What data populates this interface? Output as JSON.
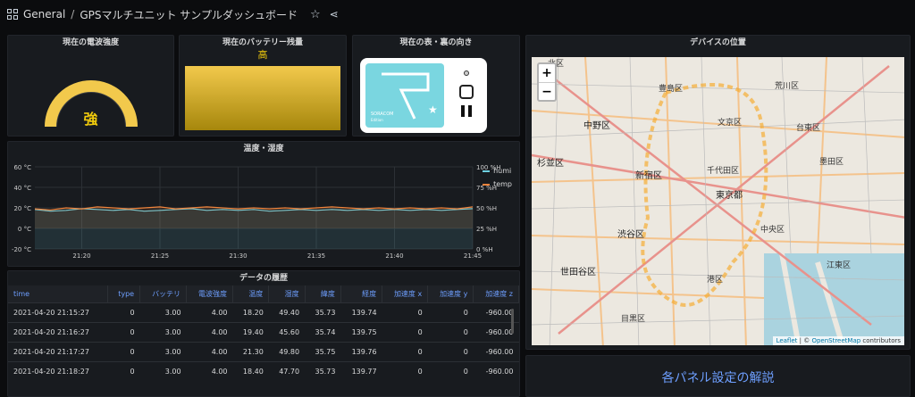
{
  "breadcrumb": {
    "folder": "General",
    "separator": "/",
    "dashboard": "GPSマルチユニット サンプルダッシュボード"
  },
  "panels": {
    "signal": {
      "title": "現在の電波強度",
      "value": "強",
      "level": 0.85
    },
    "battery": {
      "title": "現在のバッテリー残量",
      "value": "高",
      "level": 1.0
    },
    "orientation": {
      "title": "現在の表・裏の向き",
      "brand": "SORACOM",
      "sub": "Edition"
    },
    "chart": {
      "title": "温度・湿度"
    },
    "table": {
      "title": "データの履歴"
    },
    "map": {
      "title": "デバイスの位置"
    },
    "explain": {
      "title": "各パネル設定の解説"
    }
  },
  "chart_data": {
    "type": "line",
    "x": [
      "21:17",
      "21:18",
      "21:19",
      "21:20",
      "21:21",
      "21:22",
      "21:23",
      "21:24",
      "21:25",
      "21:26",
      "21:27",
      "21:28",
      "21:29",
      "21:30",
      "21:31",
      "21:32",
      "21:33",
      "21:34",
      "21:35",
      "21:36",
      "21:37",
      "21:38",
      "21:39",
      "21:40",
      "21:41",
      "21:42",
      "21:43",
      "21:44",
      "21:45"
    ],
    "x_ticks": [
      "21:20",
      "21:25",
      "21:30",
      "21:35",
      "21:40",
      "21:45"
    ],
    "left_axis": {
      "ticks": [
        "60 °C",
        "40 °C",
        "20 °C",
        "0 °C",
        "-20 °C"
      ],
      "ylim": [
        -20,
        60
      ]
    },
    "right_axis": {
      "ticks": [
        "100 %H",
        "75 %H",
        "50 %H",
        "25 %H",
        "0 %H"
      ],
      "ylim": [
        0,
        100
      ]
    },
    "series": [
      {
        "name": "humi",
        "color": "#6ed0e0",
        "axis": "right",
        "values": [
          48,
          46,
          47,
          49,
          48,
          47,
          48,
          46,
          47,
          48,
          49,
          47,
          48,
          47,
          48,
          46,
          47,
          48,
          47,
          48,
          47,
          48,
          47,
          48,
          47,
          48,
          47,
          48,
          49
        ]
      },
      {
        "name": "temp",
        "color": "#ef843c",
        "axis": "left",
        "values": [
          19,
          18,
          20,
          19,
          21,
          20,
          19,
          20,
          21,
          19,
          20,
          21,
          20,
          19,
          20,
          19,
          20,
          19,
          20,
          21,
          20,
          19,
          20,
          19,
          20,
          19,
          20,
          19,
          21
        ]
      }
    ]
  },
  "table": {
    "columns": [
      "time",
      "type",
      "バッテリ",
      "電波強度",
      "温度",
      "湿度",
      "緯度",
      "経度",
      "加速度 x",
      "加速度 y",
      "加速度 z"
    ],
    "rows": [
      [
        "2021-04-20 21:15:27",
        "0",
        "3.00",
        "4.00",
        "18.20",
        "49.40",
        "35.73",
        "139.74",
        "0",
        "0",
        "-960.00"
      ],
      [
        "2021-04-20 21:16:27",
        "0",
        "3.00",
        "4.00",
        "19.40",
        "45.60",
        "35.74",
        "139.75",
        "0",
        "0",
        "-960.00"
      ],
      [
        "2021-04-20 21:17:27",
        "0",
        "3.00",
        "4.00",
        "21.30",
        "49.80",
        "35.75",
        "139.76",
        "0",
        "0",
        "-960.00"
      ],
      [
        "2021-04-20 21:18:27",
        "0",
        "3.00",
        "4.00",
        "18.40",
        "47.70",
        "35.73",
        "139.77",
        "0",
        "0",
        "-960.00"
      ]
    ]
  },
  "map": {
    "zoom_in": "+",
    "zoom_out": "−",
    "attribution_leaflet": "Leaflet",
    "attribution_sep": " | © ",
    "attribution_osm": "OpenStreetMap",
    "attribution_tail": " contributors",
    "labels": [
      "豊島区",
      "荒川区",
      "北区",
      "中野区",
      "文京区",
      "台東区",
      "杉並区",
      "新宿区",
      "千代田区",
      "墨田区",
      "東京都",
      "渋谷区",
      "中央区",
      "世田谷区",
      "江東区",
      "港区",
      "目黒区"
    ]
  }
}
